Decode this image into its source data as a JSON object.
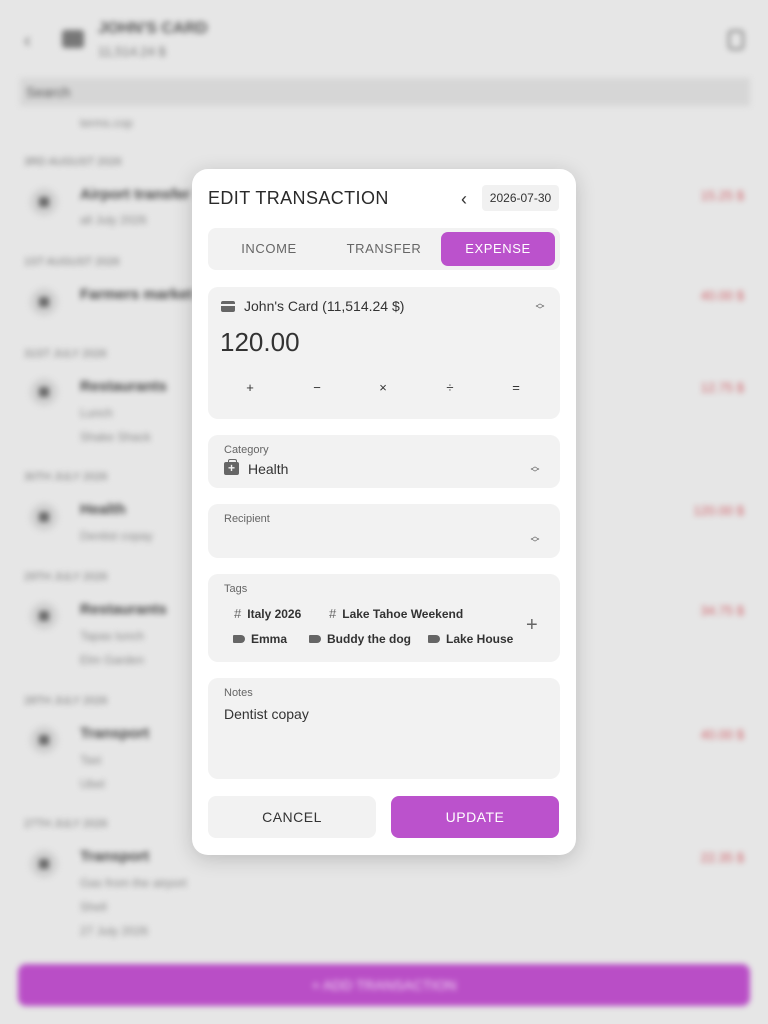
{
  "background": {
    "title": "JOHN'S CARD",
    "subtitle": "11,514.24 $",
    "search_placeholder": "Search",
    "top_note": "terms.cop",
    "add_transaction": "+ ADD TRANSACTION",
    "groups": [
      {
        "date": "3RD AUGUST 2026",
        "title": "Airport transfer",
        "sub": [
          "all July 2026"
        ],
        "amount": "15.25 $"
      },
      {
        "date": "1ST AUGUST 2026",
        "title": "Farmers market",
        "sub": [],
        "amount": "40.00 $"
      },
      {
        "date": "31ST JULY 2026",
        "title": "Restaurants",
        "sub": [
          "Lunch",
          "Shake Shack"
        ],
        "amount": "12.75 $"
      },
      {
        "date": "30TH JULY 2026",
        "title": "Health",
        "sub": [
          "Dentist copay"
        ],
        "amount": "120.00 $"
      },
      {
        "date": "29TH JULY 2026",
        "title": "Restaurants",
        "sub": [
          "Tapas lunch",
          "Elm Garden"
        ],
        "amount": "34.75 $"
      },
      {
        "date": "28TH JULY 2026",
        "title": "Transport",
        "sub": [
          "Taxi",
          "Ubel"
        ],
        "amount": "40.00 $"
      },
      {
        "date": "27TH JULY 2026",
        "title": "Transport",
        "sub": [
          "Gas from the airport",
          "Shell",
          "27 July 2026"
        ],
        "amount": "22.35 $"
      }
    ]
  },
  "dialog": {
    "title": "EDIT TRANSACTION",
    "date": "2026-07-30",
    "tabs": [
      "INCOME",
      "TRANSFER",
      "EXPENSE"
    ],
    "account": "John's Card (11,514.24 $)",
    "amount": "120.00",
    "operators": [
      "+",
      "−",
      "×",
      "÷",
      "="
    ],
    "category_label": "Category",
    "category_value": "Health",
    "recipient_label": "Recipient",
    "tags_label": "Tags",
    "tags": [
      {
        "kind": "hash",
        "name": "Italy 2026"
      },
      {
        "kind": "hash",
        "name": "Lake Tahoe Weekend"
      },
      {
        "kind": "label",
        "name": "Emma"
      },
      {
        "kind": "label",
        "name": "Buddy the dog"
      },
      {
        "kind": "label",
        "name": "Lake House"
      }
    ],
    "notes_label": "Notes",
    "notes_value": "Dentist copay",
    "cancel_label": "CANCEL",
    "update_label": "UPDATE"
  },
  "colors": {
    "accent": "#bb52cc",
    "expense_amount": "#d0626a"
  }
}
